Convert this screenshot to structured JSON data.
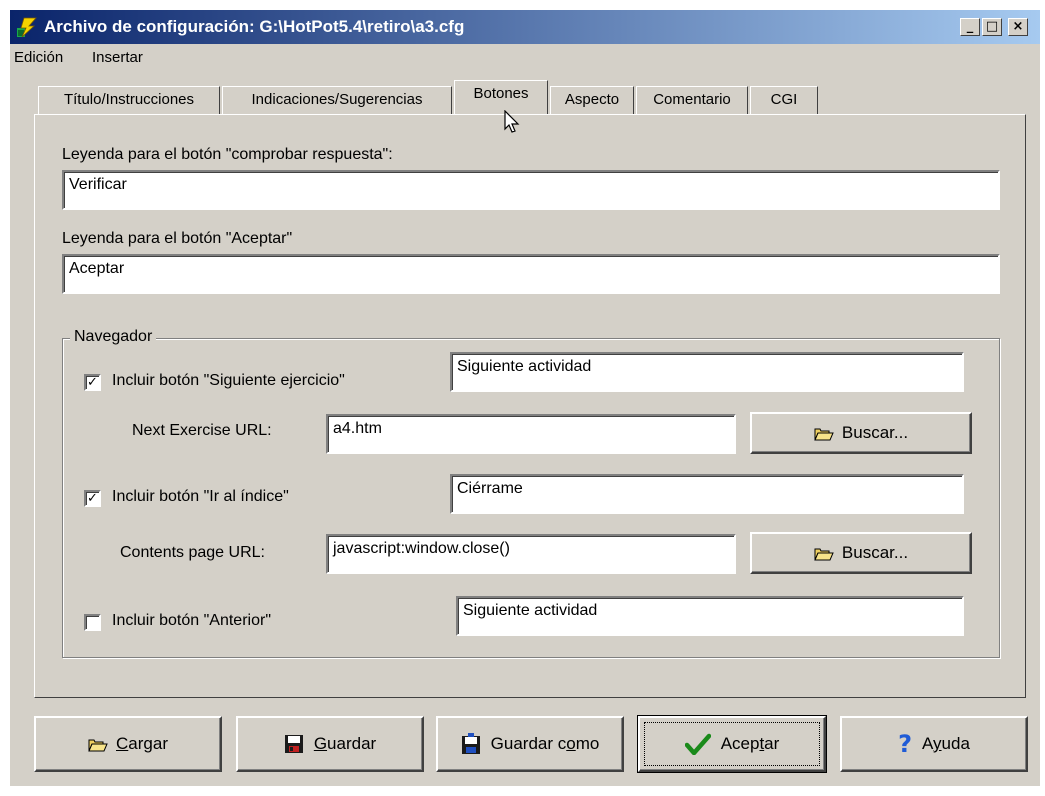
{
  "window": {
    "title": "Archivo de configuración: G:\\HotPot5.4\\retiro\\a3.cfg",
    "controls": {
      "minimize": "_",
      "maximize": "□",
      "close": "×"
    }
  },
  "menu": {
    "items": [
      "Edición",
      "Insertar"
    ]
  },
  "tabs": [
    {
      "label": "Título/Instrucciones"
    },
    {
      "label": "Indicaciones/Sugerencias"
    },
    {
      "label": "Botones"
    },
    {
      "label": "Aspecto"
    },
    {
      "label": "Comentario"
    },
    {
      "label": "CGI"
    }
  ],
  "active_tab": "Botones",
  "form": {
    "check_label": "Leyenda para el botón \"comprobar respuesta\":",
    "check_value": "Verificar",
    "accept_label": "Leyenda para el botón \"Aceptar\"",
    "accept_value": "Aceptar",
    "navigator": {
      "legend": "Navegador",
      "next": {
        "checkbox_label": "Incluir botón \"Siguiente ejercicio\"",
        "checked": true,
        "caption": "Siguiente actividad",
        "url_label": "Next Exercise URL:",
        "url_value": "a4.htm",
        "browse_label": "Buscar..."
      },
      "index": {
        "checkbox_label": "Incluir botón  \"Ir al índice\"",
        "checked": true,
        "caption": "Ciérrame",
        "url_label": "Contents page URL:",
        "url_value": "javascript:window.close()",
        "browse_label": "Buscar..."
      },
      "previous": {
        "checkbox_label": "Incluir botón \"Anterior\"",
        "checked": false,
        "caption": "Siguiente actividad"
      }
    }
  },
  "footer": {
    "load": {
      "prefix": "",
      "accel": "C",
      "suffix": "argar"
    },
    "save": {
      "prefix": "",
      "accel": "G",
      "suffix": "uardar"
    },
    "save_as": {
      "prefix": "Guardar c",
      "accel": "o",
      "suffix": "mo"
    },
    "accept": {
      "prefix": "Acep",
      "accel": "t",
      "suffix": "ar"
    },
    "help": {
      "prefix": "A",
      "accel": "y",
      "suffix": "uda"
    }
  },
  "colors": {
    "titlebar_start": "#0a246a",
    "titlebar_end": "#a6caf0",
    "face": "#d4d0c8",
    "help_icon": "#1f5bd6",
    "check_icon": "#1a8a1a"
  }
}
